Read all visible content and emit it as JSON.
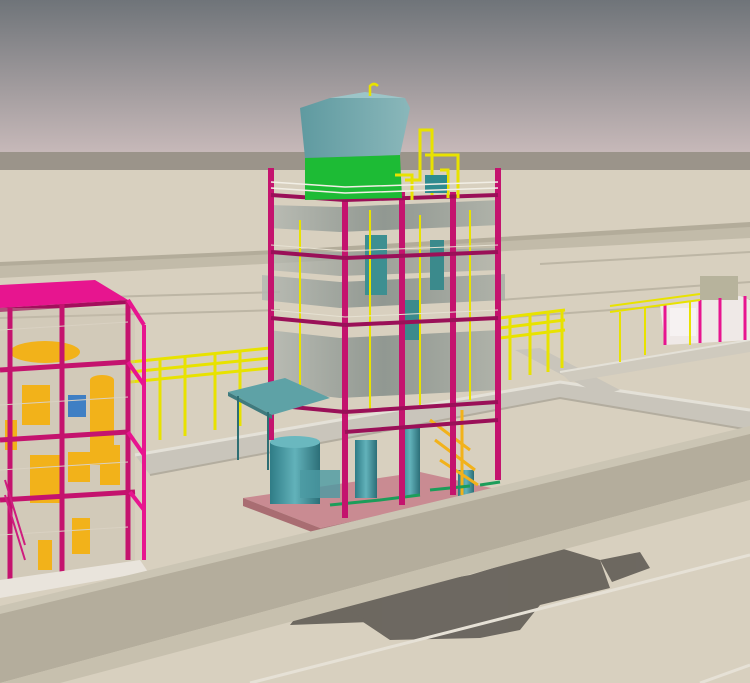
{
  "scene": {
    "subject": "industrial-plant-3d-render",
    "colors": {
      "sky_top": "#6f7479",
      "sky_bottom": "#cbbcbc",
      "horizon_wall": "#9b948a",
      "ground": "#d8d0bf",
      "road": "#c9c5bb",
      "road_edge": "#e4e1d8",
      "steel_magenta": "#c4136e",
      "steel_pink": "#e7158f",
      "pipe_yellow": "#e8e200",
      "vessel_orange": "#f2b21a",
      "tank_teal": "#4b9aa3",
      "cladding_grey": "#8f9792",
      "module_green": "#1dbb35",
      "hood_cyan": "#6fa3a8",
      "foreground_wall": "#b4ad9c",
      "shadow": "#5b5650"
    }
  }
}
